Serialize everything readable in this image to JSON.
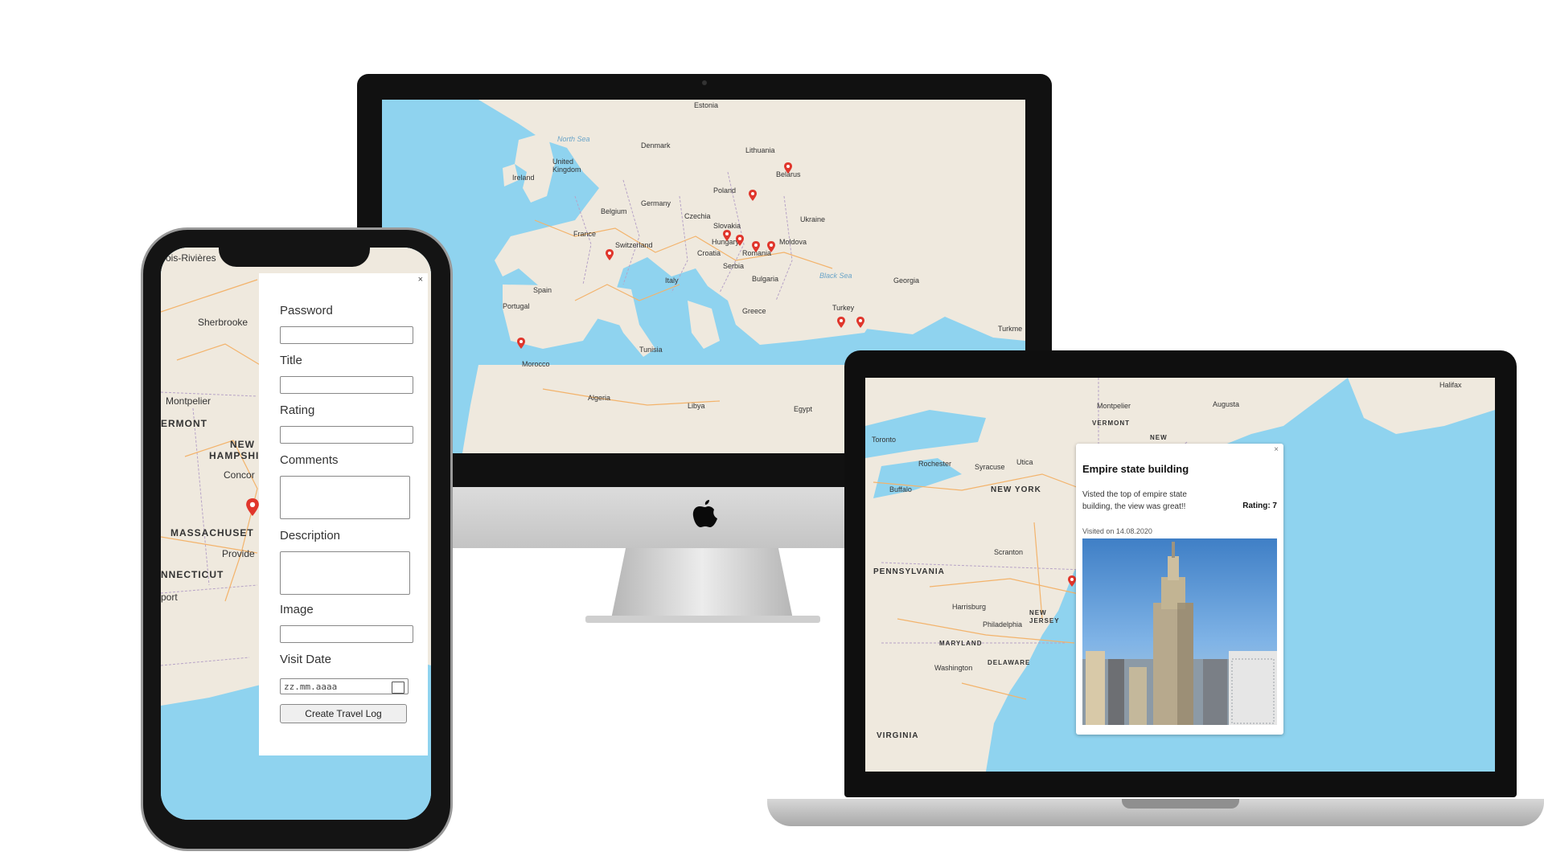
{
  "imac_map": {
    "labels": {
      "estonia": "Estonia",
      "north_sea": "North Sea",
      "denmark": "Denmark",
      "lithuania": "Lithuania",
      "united_kingdom": "United Kingdom",
      "ireland": "Ireland",
      "belarus": "Belarus",
      "poland": "Poland",
      "germany": "Germany",
      "belgium": "Belgium",
      "czechia": "Czechia",
      "ukraine": "Ukraine",
      "slovakia": "Slovakia",
      "moldova": "Moldova",
      "france": "France",
      "switzerland": "Switzerland",
      "hungary": "Hungary",
      "romania": "Romania",
      "croatia": "Croatia",
      "serbia": "Serbia",
      "bulgaria": "Bulgaria",
      "italy": "Italy",
      "spain": "Spain",
      "portugal": "Portugal",
      "greece": "Greece",
      "turkey": "Turkey",
      "georgia": "Georgia",
      "black_sea": "Black Sea",
      "tunisia": "Tunisia",
      "morocco": "Morocco",
      "algeria": "Algeria",
      "libya": "Libya",
      "egypt": "Egypt",
      "turkmen": "Turkme"
    }
  },
  "laptop_map": {
    "labels": {
      "toronto": "Toronto",
      "montpelier": "Montpelier",
      "vermont": "VERMONT",
      "new": "NEW",
      "augusta": "Augusta",
      "halifax": "Halifax",
      "rochester": "Rochester",
      "syracuse": "Syracuse",
      "utica": "Utica",
      "buffalo": "Buffalo",
      "new_york": "NEW YORK",
      "scranton": "Scranton",
      "pennsylvania": "PENNSYLVANIA",
      "harrisburg": "Harrisburg",
      "philadelphia": "Philadelphia",
      "new_jersey": "NEW JERSEY",
      "maryland": "MARYLAND",
      "delaware": "DELAWARE",
      "washington": "Washington",
      "virginia": "VIRGINIA"
    },
    "popup": {
      "close": "×",
      "title": "Empire state building",
      "comment": "Visted the top of empire state building, the view was great!!",
      "rating": "Rating: 7",
      "visited": "Visited on 14.08.2020"
    }
  },
  "phone": {
    "map_labels": {
      "trois_rivieres": "rois-Rivières",
      "sherbrooke": "Sherbrooke",
      "montpelier": "Montpelier",
      "vermont": "ERMONT",
      "new": "NEW",
      "hampshire": "HAMPSHI",
      "concord": "Concor",
      "massachusetts": "MASSACHUSET",
      "providence": "Provide",
      "connecticut": "NNECTICUT",
      "newport": "port"
    },
    "form": {
      "close": "×",
      "password_label": "Password",
      "title_label": "Title",
      "rating_label": "Rating",
      "comments_label": "Comments",
      "description_label": "Description",
      "image_label": "Image",
      "visit_date_label": "Visit Date",
      "visit_date_placeholder": "zz.mm.aaaa",
      "submit_label": "Create Travel Log"
    }
  },
  "colors": {
    "sea": "#8fd3ef",
    "land": "#efe9de",
    "pin": "#e0362c",
    "road": "#f3b36b"
  },
  "icons": {
    "pin": "map-pin-icon",
    "apple": "apple-logo-icon",
    "calendar": "calendar-icon",
    "close": "close-icon"
  }
}
